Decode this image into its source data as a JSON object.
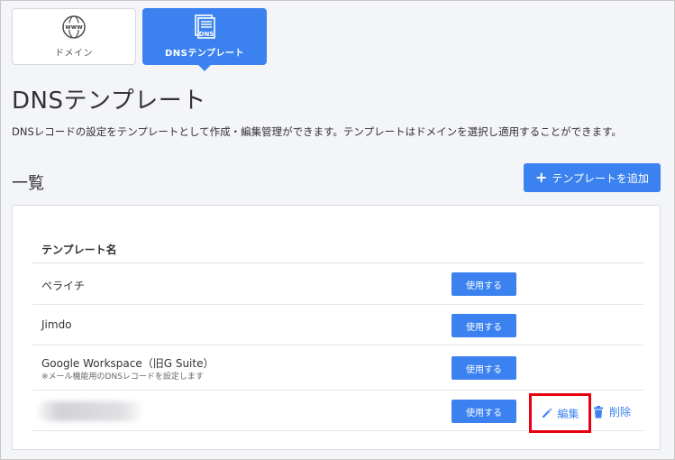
{
  "tabs": {
    "domain": {
      "label": "ドメイン",
      "icon": "www-globe-icon"
    },
    "dns_template": {
      "label": "DNSテンプレート",
      "icon": "dns-document-icon",
      "icon_text": "DNS",
      "globe_text": "www"
    }
  },
  "page": {
    "title": "DNSテンプレート",
    "description": "DNSレコードの設定をテンプレートとして作成・編集管理ができます。テンプレートはドメインを選択し適用することができます。"
  },
  "list": {
    "section_title": "一覧",
    "add_button_label": "テンプレートを追加",
    "add_button_icon": "plus-icon",
    "column_header": "テンプレート名",
    "rows": [
      {
        "name": "ペライチ",
        "sub": "",
        "use_label": "使用する"
      },
      {
        "name": "Jimdo",
        "sub": "",
        "use_label": "使用する"
      },
      {
        "name": "Google Workspace（旧G Suite）",
        "sub": "※メール機能用のDNSレコードを設定します",
        "use_label": "使用する"
      },
      {
        "name": "",
        "sub": "",
        "use_label": "使用する",
        "edit_label": "編集",
        "delete_label": "削除"
      }
    ]
  },
  "colors": {
    "accent": "#3b82f0",
    "highlight": "#e60012",
    "background": "#f4f5f9"
  }
}
